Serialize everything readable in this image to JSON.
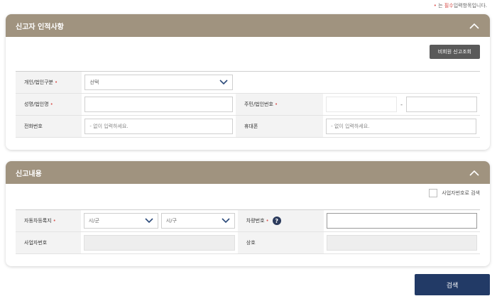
{
  "required_note": {
    "dot": "•",
    "prefix": "는 ",
    "em": "필수",
    "suffix": "입력항목입니다."
  },
  "reporter_section": {
    "title": "신고자 인적사항",
    "nonmember_lookup_button": "비회원 신고조회",
    "fields": {
      "person_type_label": "개인/법인구분",
      "person_type_value": "선택",
      "name_label": "성명/법인명",
      "resident_no_label": "주민/법인번호",
      "phone_label": "전화번호",
      "phone_placeholder": "- 없이 입력하세요.",
      "mobile_label": "휴대폰",
      "mobile_placeholder": "- 없이 입력하세요."
    }
  },
  "report_section": {
    "title": "신고내용",
    "search_by_bizno_label": "사업자번호로 검색",
    "fields": {
      "vehicle_reg_label": "자동차등록지",
      "sido_value": "시/군",
      "sigungu_value": "시/구",
      "plate_label": "차량번호",
      "help_icon_text": "?",
      "bizno_label": "사업자번호",
      "company_label": "상호"
    }
  },
  "search_button": "검색",
  "required_mark": "•",
  "colors": {
    "header_bg": "#a0937f",
    "search_button_bg": "#223a66",
    "required": "#d9534f",
    "dark_button": "#5a5a5a"
  }
}
